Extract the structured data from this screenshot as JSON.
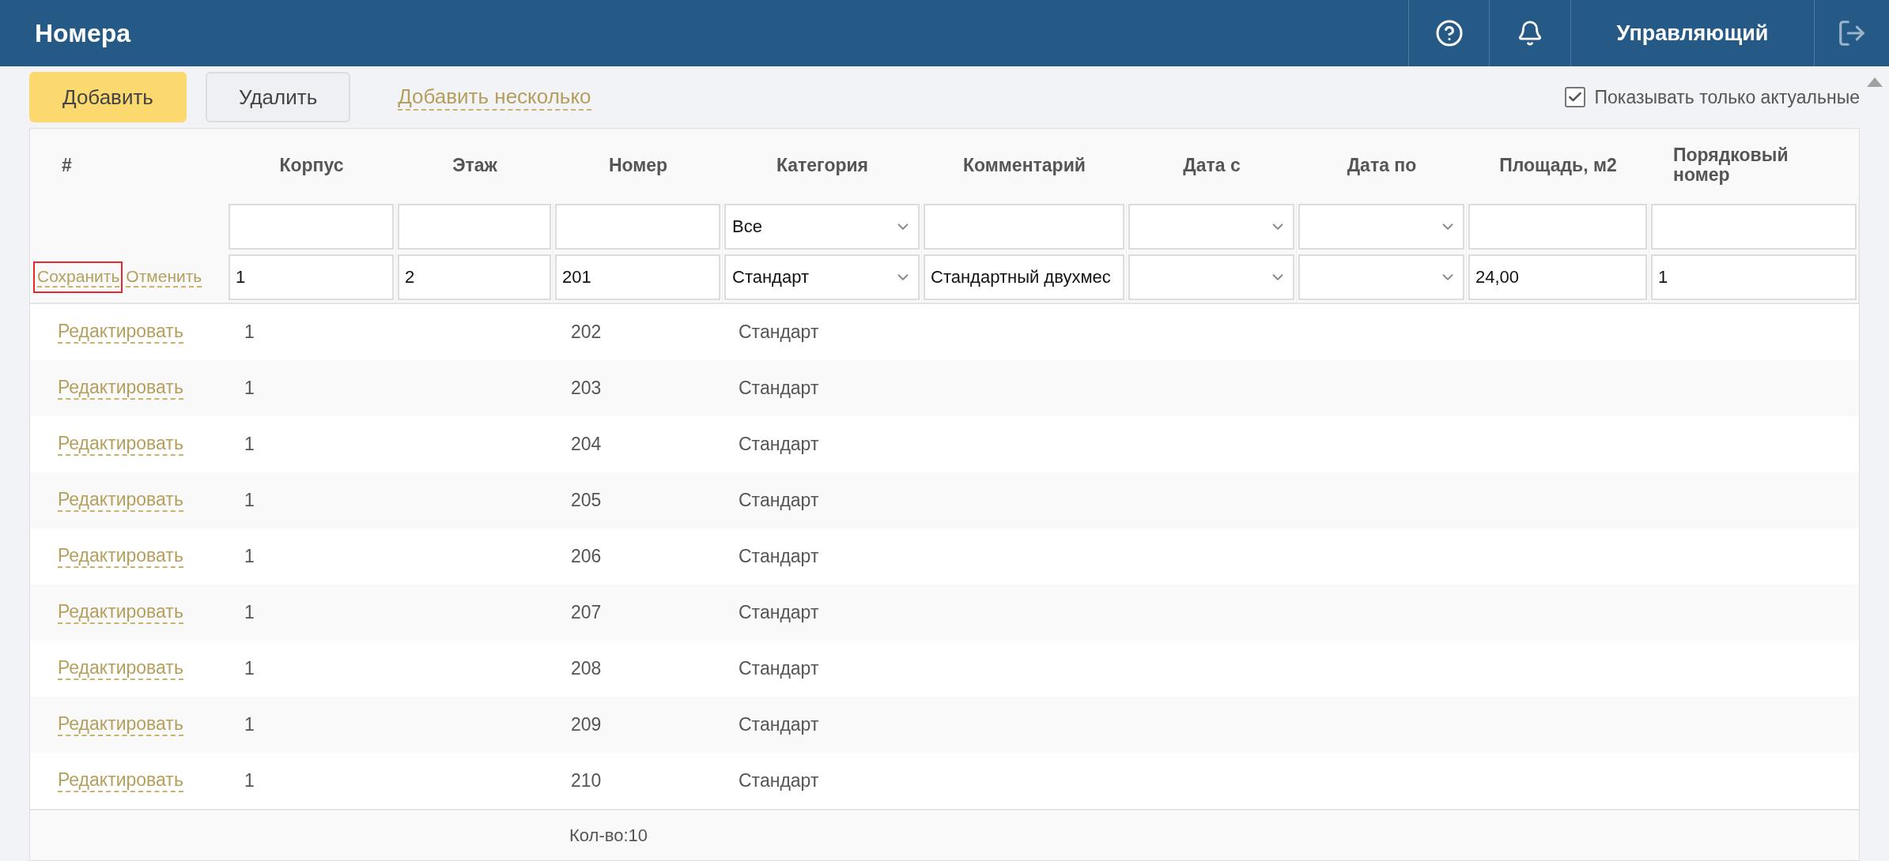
{
  "header": {
    "title": "Номера",
    "user": "Управляющий"
  },
  "toolbar": {
    "add": "Добавить",
    "delete": "Удалить",
    "add_many": "Добавить несколько",
    "only_current": {
      "label": "Показывать только актуальные",
      "checked": true
    }
  },
  "table": {
    "columns": [
      "#",
      "Корпус",
      "Этаж",
      "Номер",
      "Категория",
      "Комментарий",
      "Дата с",
      "Дата по",
      "Площадь, м2",
      "Порядковый номер"
    ],
    "filters": [
      {
        "kind": "text"
      },
      {
        "kind": "text"
      },
      {
        "kind": "text"
      },
      {
        "kind": "select",
        "value": "Все"
      },
      {
        "kind": "text"
      },
      {
        "kind": "select"
      },
      {
        "kind": "select"
      },
      {
        "kind": "text"
      },
      {
        "kind": "text"
      }
    ],
    "edit_row": {
      "save": {
        "label": "Сохранить",
        "focused": true
      },
      "cancel": "Отменить",
      "cells": [
        {
          "kind": "text",
          "value": "1"
        },
        {
          "kind": "text",
          "value": "2"
        },
        {
          "kind": "text",
          "value": "201"
        },
        {
          "kind": "select",
          "value": "Стандарт"
        },
        {
          "kind": "text",
          "value": "Стандартный двухмес"
        },
        {
          "kind": "select"
        },
        {
          "kind": "select"
        },
        {
          "kind": "text",
          "value": "24,00"
        },
        {
          "kind": "text",
          "value": "1"
        }
      ]
    },
    "rows": [
      {
        "action": "Редактировать",
        "corpus": "1",
        "number": "202",
        "category": "Стандарт"
      },
      {
        "action": "Редактировать",
        "corpus": "1",
        "number": "203",
        "category": "Стандарт"
      },
      {
        "action": "Редактировать",
        "corpus": "1",
        "number": "204",
        "category": "Стандарт"
      },
      {
        "action": "Редактировать",
        "corpus": "1",
        "number": "205",
        "category": "Стандарт"
      },
      {
        "action": "Редактировать",
        "corpus": "1",
        "number": "206",
        "category": "Стандарт"
      },
      {
        "action": "Редактировать",
        "corpus": "1",
        "number": "207",
        "category": "Стандарт"
      },
      {
        "action": "Редактировать",
        "corpus": "1",
        "number": "208",
        "category": "Стандарт"
      },
      {
        "action": "Редактировать",
        "corpus": "1",
        "number": "209",
        "category": "Стандарт"
      },
      {
        "action": "Редактировать",
        "corpus": "1",
        "number": "210",
        "category": "Стандарт"
      }
    ],
    "footer": {
      "count": "Кол-во:10"
    }
  }
}
